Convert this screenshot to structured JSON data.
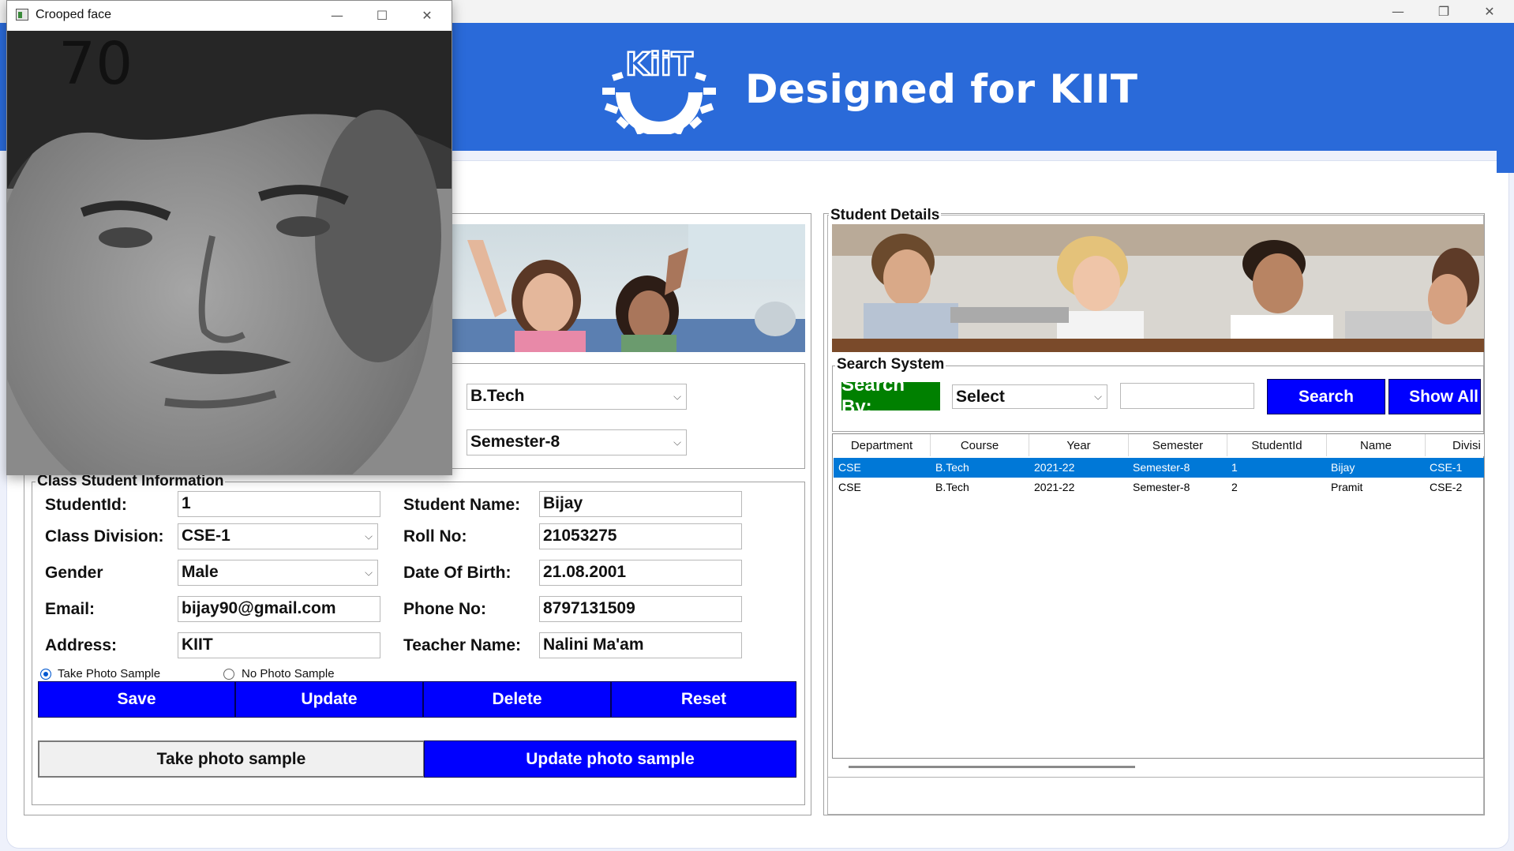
{
  "banner": {
    "title": "Designed for KIIT",
    "logo_text": "KiiT"
  },
  "popup": {
    "title": "Crooped face",
    "overlay_number": "70"
  },
  "course": {
    "course_value": "B.Tech",
    "semester_value": "Semester-8"
  },
  "class_info": {
    "title": "Class Student Information",
    "student_id_label": "StudentId:",
    "student_id_value": "1",
    "student_name_label": "Student Name:",
    "student_name_value": "Bijay",
    "division_label": "Class Division:",
    "division_value": "CSE-1",
    "roll_label": "Roll No:",
    "roll_value": "21053275",
    "gender_label": "Gender",
    "gender_value": "Male",
    "dob_label": "Date Of Birth:",
    "dob_value": "21.08.2001",
    "email_label": "Email:",
    "email_value": "bijay90@gmail.com",
    "phone_label": "Phone No:",
    "phone_value": "8797131509",
    "address_label": "Address:",
    "address_value": "KIIT",
    "teacher_label": "Teacher Name:",
    "teacher_value": "Nalini Ma'am",
    "radio_take": "Take Photo Sample",
    "radio_none": "No Photo Sample",
    "save": "Save",
    "update": "Update",
    "delete": "Delete",
    "reset": "Reset",
    "take_photo": "Take photo sample",
    "update_photo": "Update photo sample"
  },
  "student_details": {
    "title": "Student Details",
    "search_title": "Search System",
    "search_by": "Search By:",
    "search_select": "Select",
    "search_value": "",
    "search_btn": "Search",
    "show_all_btn": "Show All",
    "columns": [
      "Department",
      "Course",
      "Year",
      "Semester",
      "StudentId",
      "Name",
      "Divisi"
    ],
    "rows": [
      [
        "CSE",
        "B.Tech",
        "2021-22",
        "Semester-8",
        "1",
        "Bijay",
        "CSE-1"
      ],
      [
        "CSE",
        "B.Tech",
        "2021-22",
        "Semester-8",
        "2",
        "Pramit",
        "CSE-2"
      ]
    ]
  },
  "colors": {
    "banner": "#2a6ad9",
    "button": "#0000ff",
    "search_by": "#008000",
    "selected_row": "#0078d7"
  },
  "icons": {
    "minimize": "minimize-icon",
    "maximize": "maximize-icon",
    "close": "close-icon",
    "restore": "restore-icon",
    "dropdown": "chevron-down-icon"
  }
}
